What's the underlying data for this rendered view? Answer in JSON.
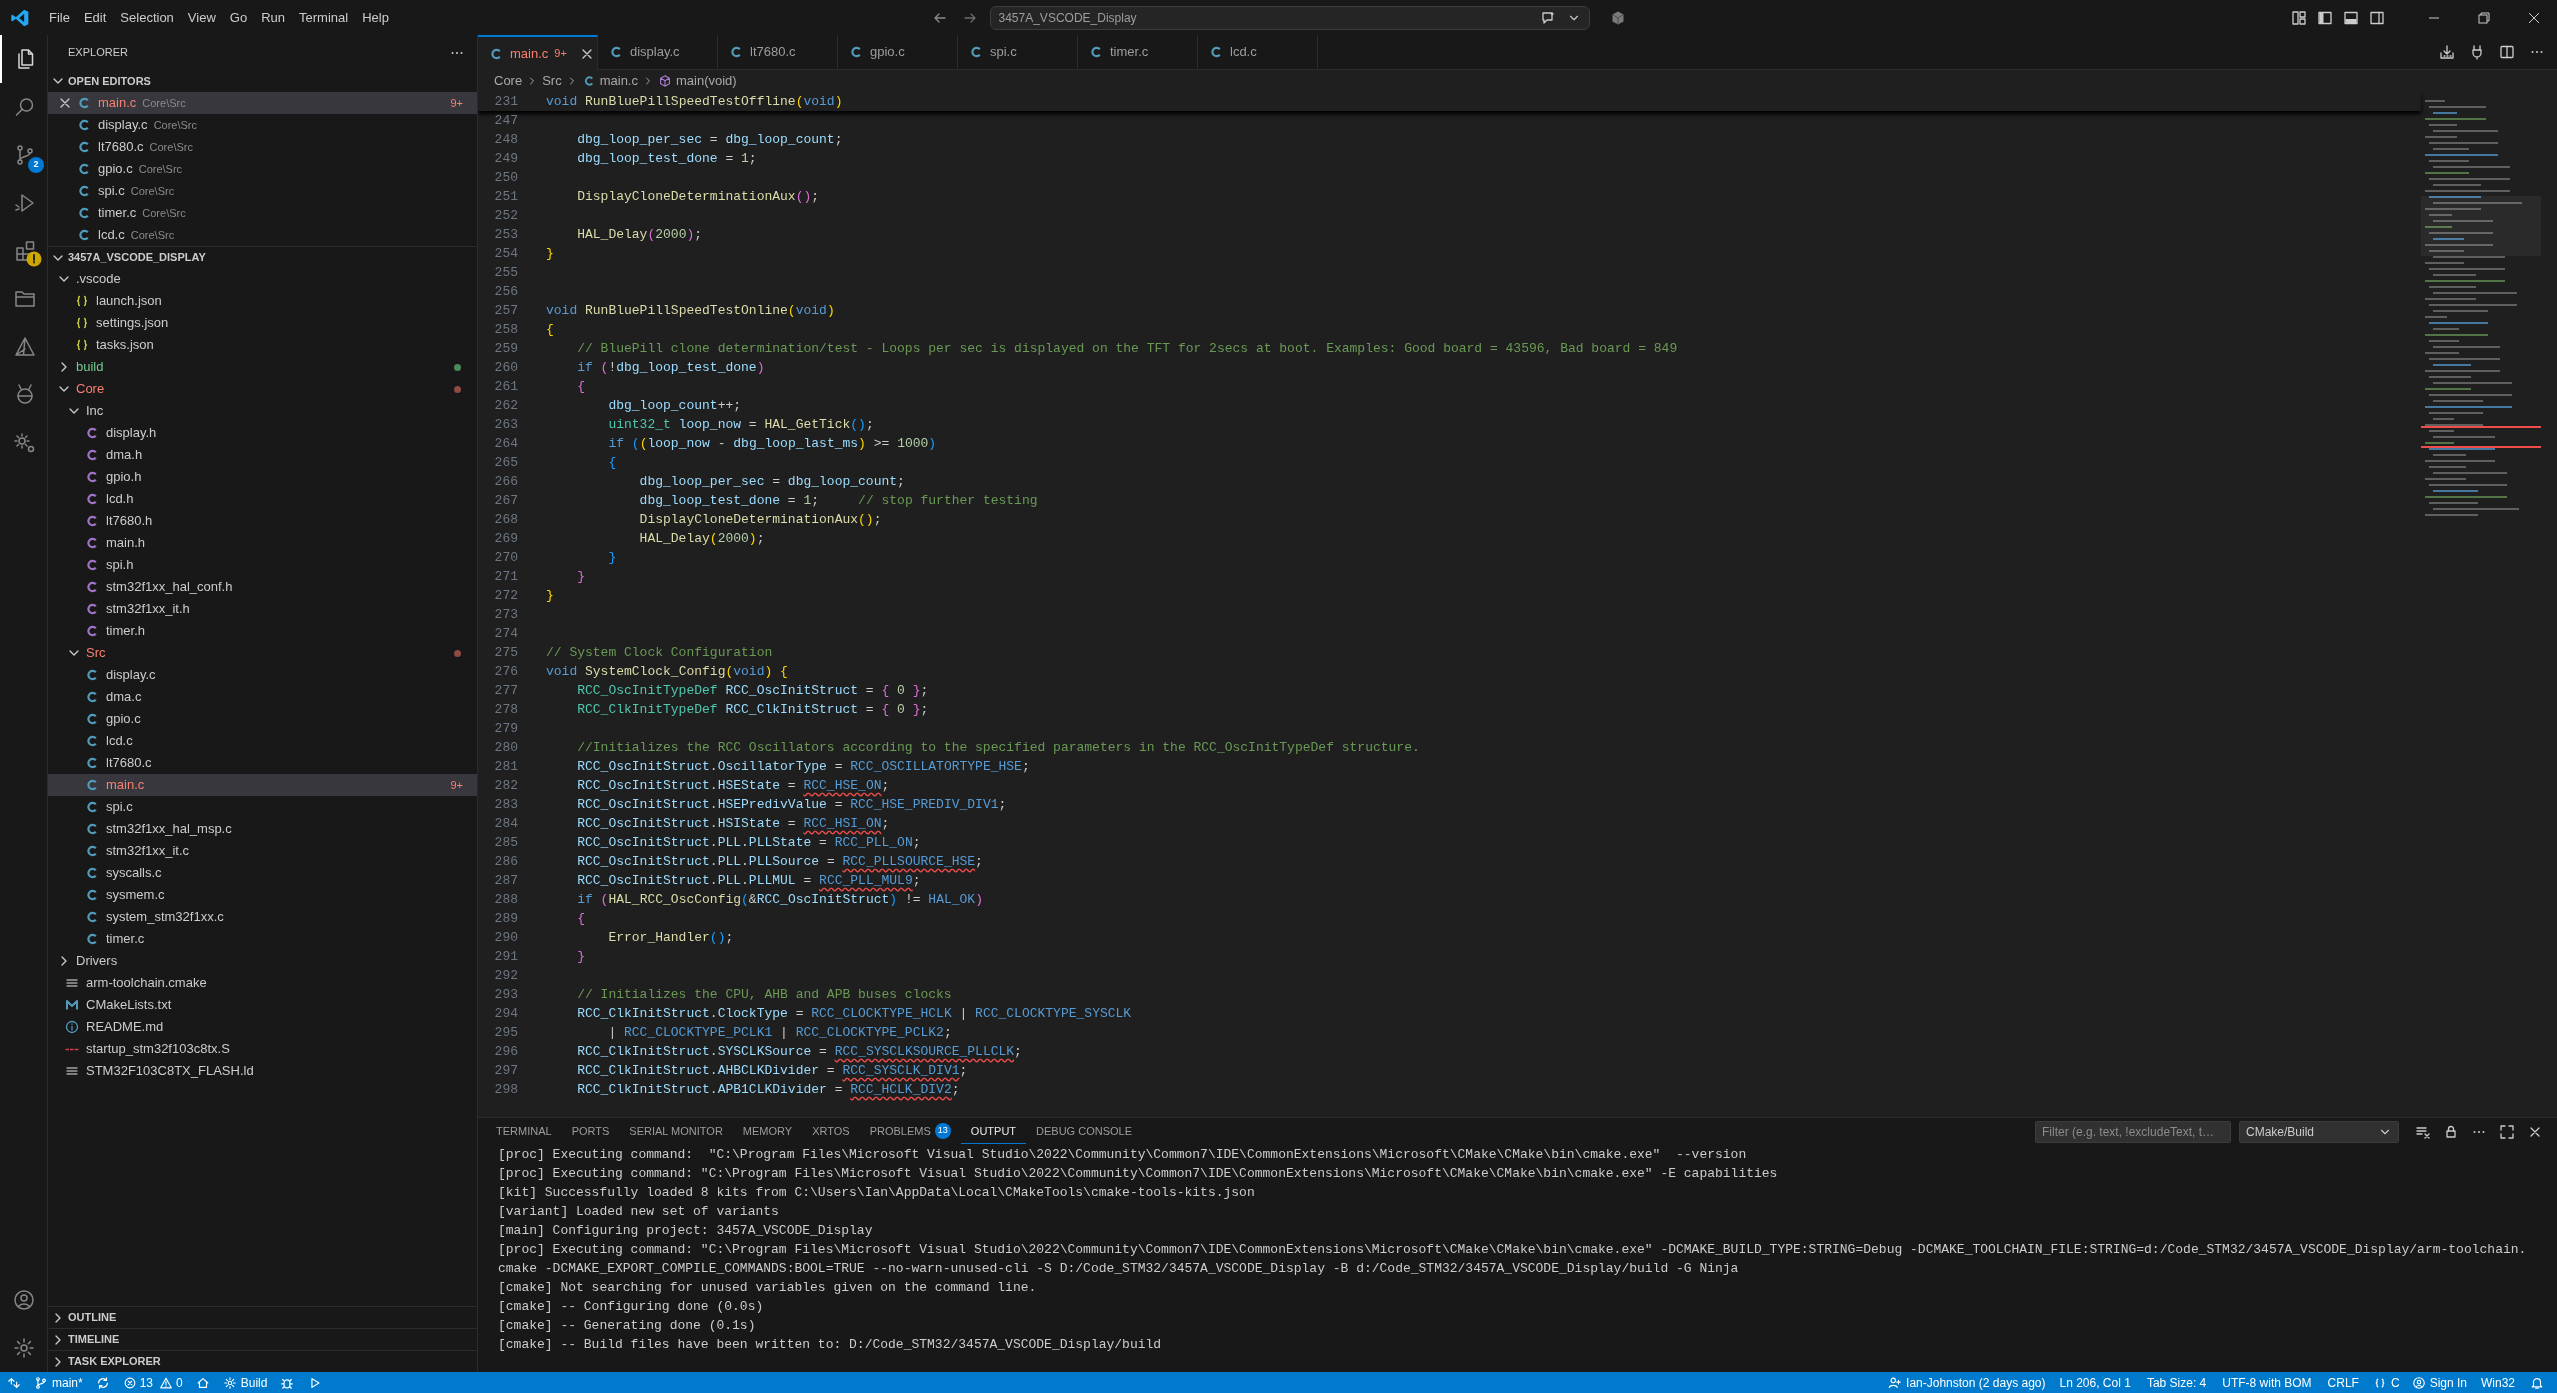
{
  "title_bar": {
    "menu": [
      "File",
      "Edit",
      "Selection",
      "View",
      "Go",
      "Run",
      "Terminal",
      "Help"
    ],
    "search": "3457A_VSCODE_Display"
  },
  "activity_bar": {
    "items": [
      {
        "kind": "explorer",
        "selected": true
      },
      {
        "kind": "search",
        "selected": false
      },
      {
        "kind": "scm",
        "selected": false,
        "badge": "2"
      },
      {
        "kind": "run",
        "selected": false
      },
      {
        "kind": "extensions",
        "selected": false,
        "warning": true
      },
      {
        "kind": "folder",
        "selected": false
      },
      {
        "kind": "cmake",
        "selected": false
      },
      {
        "kind": "platformio",
        "selected": false
      },
      {
        "kind": "gears",
        "selected": false
      }
    ],
    "bottom": [
      {
        "kind": "account"
      },
      {
        "kind": "settings"
      }
    ]
  },
  "explorer": {
    "title": "EXPLORER",
    "open_editors": {
      "title": "OPEN EDITORS",
      "expanded": true,
      "items": [
        {
          "name": "main.c",
          "path": "Core\\Src",
          "kind": "c",
          "selected": true,
          "has_errors": true,
          "badge": "9+"
        },
        {
          "name": "display.c",
          "path": "Core\\Src",
          "kind": "c",
          "selected": false
        },
        {
          "name": "lt7680.c",
          "path": "Core\\Src",
          "kind": "c",
          "selected": false
        },
        {
          "name": "gpio.c",
          "path": "Core\\Src",
          "kind": "c",
          "selected": false
        },
        {
          "name": "spi.c",
          "path": "Core\\Src",
          "kind": "c",
          "selected": false
        },
        {
          "name": "timer.c",
          "path": "Core\\Src",
          "kind": "c",
          "selected": false
        },
        {
          "name": "lcd.c",
          "path": "Core\\Src",
          "kind": "c",
          "selected": false
        }
      ]
    },
    "project": {
      "title": "3457A_VSCODE_DISPLAY",
      "expanded": true,
      "children": [
        {
          "name": ".vscode",
          "kind": "folder",
          "expanded": true,
          "children": [
            {
              "name": "launch.json",
              "kind": "json"
            },
            {
              "name": "settings.json",
              "kind": "json"
            },
            {
              "name": "tasks.json",
              "kind": "json"
            }
          ]
        },
        {
          "name": "build",
          "kind": "folder",
          "expanded": false,
          "untracked": true
        },
        {
          "name": "Core",
          "kind": "folder",
          "expanded": true,
          "has_errors": true,
          "children": [
            {
              "name": "Inc",
              "kind": "folder",
              "expanded": true,
              "children": [
                {
                  "name": "display.h",
                  "kind": "h"
                },
                {
                  "name": "dma.h",
                  "kind": "h"
                },
                {
                  "name": "gpio.h",
                  "kind": "h"
                },
                {
                  "name": "lcd.h",
                  "kind": "h"
                },
                {
                  "name": "lt7680.h",
                  "kind": "h"
                },
                {
                  "name": "main.h",
                  "kind": "h"
                },
                {
                  "name": "spi.h",
                  "kind": "h"
                },
                {
                  "name": "stm32f1xx_hal_conf.h",
                  "kind": "h"
                },
                {
                  "name": "stm32f1xx_it.h",
                  "kind": "h"
                },
                {
                  "name": "timer.h",
                  "kind": "h"
                }
              ]
            },
            {
              "name": "Src",
              "kind": "folder",
              "expanded": true,
              "has_errors": true,
              "children": [
                {
                  "name": "display.c",
                  "kind": "c"
                },
                {
                  "name": "dma.c",
                  "kind": "c"
                },
                {
                  "name": "gpio.c",
                  "kind": "c"
                },
                {
                  "name": "lcd.c",
                  "kind": "c"
                },
                {
                  "name": "lt7680.c",
                  "kind": "c"
                },
                {
                  "name": "main.c",
                  "kind": "c",
                  "selected": true,
                  "has_errors": true,
                  "badge": "9+"
                },
                {
                  "name": "spi.c",
                  "kind": "c"
                },
                {
                  "name": "stm32f1xx_hal_msp.c",
                  "kind": "c"
                },
                {
                  "name": "stm32f1xx_it.c",
                  "kind": "c"
                },
                {
                  "name": "syscalls.c",
                  "kind": "c"
                },
                {
                  "name": "sysmem.c",
                  "kind": "c"
                },
                {
                  "name": "system_stm32f1xx.c",
                  "kind": "c"
                },
                {
                  "name": "timer.c",
                  "kind": "c"
                }
              ]
            }
          ]
        },
        {
          "name": "Drivers",
          "kind": "folder",
          "expanded": false
        },
        {
          "name": "arm-toolchain.cmake",
          "kind": "lines"
        },
        {
          "name": "CMakeLists.txt",
          "kind": "cmakelists"
        },
        {
          "name": "README.md",
          "kind": "info"
        },
        {
          "name": "startup_stm32f103c8tx.S",
          "kind": "asm"
        },
        {
          "name": "STM32F103C8TX_FLASH.ld",
          "kind": "lines"
        }
      ]
    },
    "sections": [
      {
        "title": "OUTLINE",
        "expanded": false
      },
      {
        "title": "TIMELINE",
        "expanded": false
      },
      {
        "title": "TASK EXPLORER",
        "expanded": false
      }
    ]
  },
  "tabs": [
    {
      "label": "main.c",
      "selected": true,
      "has_errors": true,
      "badge": "9+"
    },
    {
      "label": "display.c",
      "selected": false
    },
    {
      "label": "lt7680.c",
      "selected": false
    },
    {
      "label": "gpio.c",
      "selected": false
    },
    {
      "label": "spi.c",
      "selected": false
    },
    {
      "label": "timer.c",
      "selected": false
    },
    {
      "label": "lcd.c",
      "selected": false
    }
  ],
  "breadcrumb": [
    {
      "label": "Core",
      "kind": "folder"
    },
    {
      "label": "Src",
      "kind": "folder"
    },
    {
      "label": "main.c",
      "kind": "file"
    },
    {
      "label": "main(void)",
      "kind": "function"
    }
  ],
  "editor": {
    "sticky": {
      "number": "231",
      "segments": [
        {
          "kind": "k",
          "text": "void "
        },
        {
          "kind": "f",
          "text": "RunBluePillSpeedTestOffline"
        },
        {
          "kind": "y",
          "text": "("
        },
        {
          "kind": "k",
          "text": "void"
        },
        {
          "kind": "y",
          "text": ")"
        }
      ]
    },
    "lines": [
      {
        "number": "247"
      },
      {
        "number": "248",
        "segments": [
          {
            "kind": "v",
            "text": "    dbg_loop_per_sec"
          },
          {
            "kind": "p",
            "text": " = "
          },
          {
            "kind": "v",
            "text": "dbg_loop_count"
          },
          {
            "kind": "p",
            "text": ";"
          }
        ]
      },
      {
        "number": "249",
        "segments": [
          {
            "kind": "v",
            "text": "    dbg_loop_test_done"
          },
          {
            "kind": "p",
            "text": " = "
          },
          {
            "kind": "n",
            "text": "1"
          },
          {
            "kind": "p",
            "text": ";"
          }
        ]
      },
      {
        "number": "250"
      },
      {
        "number": "251",
        "segments": [
          {
            "kind": "f",
            "text": "    DisplayCloneDeterminationAux"
          },
          {
            "kind": "pk",
            "text": "()"
          },
          {
            "kind": "p",
            "text": ";"
          }
        ]
      },
      {
        "number": "252"
      },
      {
        "number": "253",
        "segments": [
          {
            "kind": "f",
            "text": "    HAL_Delay"
          },
          {
            "kind": "pk",
            "text": "("
          },
          {
            "kind": "n",
            "text": "2000"
          },
          {
            "kind": "pk",
            "text": ")"
          },
          {
            "kind": "p",
            "text": ";"
          }
        ]
      },
      {
        "number": "254",
        "segments": [
          {
            "kind": "y",
            "text": "}"
          }
        ]
      },
      {
        "number": "255"
      },
      {
        "number": "256"
      },
      {
        "number": "257",
        "segments": [
          {
            "kind": "k",
            "text": "void "
          },
          {
            "kind": "f",
            "text": "RunBluePillSpeedTestOnline"
          },
          {
            "kind": "y",
            "text": "("
          },
          {
            "kind": "k",
            "text": "void"
          },
          {
            "kind": "y",
            "text": ")"
          }
        ]
      },
      {
        "number": "258",
        "segments": [
          {
            "kind": "y",
            "text": "{"
          }
        ]
      },
      {
        "number": "259",
        "segments": [
          {
            "kind": "c",
            "text": "    // BluePill clone determination/test - Loops per sec is displayed on the TFT for 2secs at boot. Examples: Good board = 43596, Bad board = 849"
          }
        ]
      },
      {
        "number": "260",
        "segments": [
          {
            "kind": "k",
            "text": "    if "
          },
          {
            "kind": "pk",
            "text": "("
          },
          {
            "kind": "p",
            "text": "!"
          },
          {
            "kind": "v",
            "text": "dbg_loop_test_done"
          },
          {
            "kind": "pk",
            "text": ")"
          }
        ]
      },
      {
        "number": "261",
        "segments": [
          {
            "kind": "pk",
            "text": "    {"
          }
        ]
      },
      {
        "number": "262",
        "segments": [
          {
            "kind": "v",
            "text": "        dbg_loop_count"
          },
          {
            "kind": "p",
            "text": "++;"
          }
        ]
      },
      {
        "number": "263",
        "segments": [
          {
            "kind": "t",
            "text": "        uint32_t "
          },
          {
            "kind": "v",
            "text": "loop_now"
          },
          {
            "kind": "p",
            "text": " = "
          },
          {
            "kind": "f",
            "text": "HAL_GetTick"
          },
          {
            "kind": "bl",
            "text": "()"
          },
          {
            "kind": "p",
            "text": ";"
          }
        ]
      },
      {
        "number": "264",
        "segments": [
          {
            "kind": "k",
            "text": "        if "
          },
          {
            "kind": "bl",
            "text": "("
          },
          {
            "kind": "y",
            "text": "("
          },
          {
            "kind": "v",
            "text": "loop_now"
          },
          {
            "kind": "p",
            "text": " - "
          },
          {
            "kind": "v",
            "text": "dbg_loop_last_ms"
          },
          {
            "kind": "y",
            "text": ")"
          },
          {
            "kind": "p",
            "text": " >= "
          },
          {
            "kind": "n",
            "text": "1000"
          },
          {
            "kind": "bl",
            "text": ")"
          }
        ]
      },
      {
        "number": "265",
        "segments": [
          {
            "kind": "bl",
            "text": "        {"
          }
        ]
      },
      {
        "number": "266",
        "segments": [
          {
            "kind": "v",
            "text": "            dbg_loop_per_sec"
          },
          {
            "kind": "p",
            "text": " = "
          },
          {
            "kind": "v",
            "text": "dbg_loop_count"
          },
          {
            "kind": "p",
            "text": ";"
          }
        ]
      },
      {
        "number": "267",
        "segments": [
          {
            "kind": "v",
            "text": "            dbg_loop_test_done"
          },
          {
            "kind": "p",
            "text": " = "
          },
          {
            "kind": "n",
            "text": "1"
          },
          {
            "kind": "p",
            "text": ";     "
          },
          {
            "kind": "c",
            "text": "// stop further testing"
          }
        ]
      },
      {
        "number": "268",
        "segments": [
          {
            "kind": "f",
            "text": "            DisplayCloneDeterminationAux"
          },
          {
            "kind": "y",
            "text": "()"
          },
          {
            "kind": "p",
            "text": ";"
          }
        ]
      },
      {
        "number": "269",
        "segments": [
          {
            "kind": "f",
            "text": "            HAL_Delay"
          },
          {
            "kind": "y",
            "text": "("
          },
          {
            "kind": "n",
            "text": "2000"
          },
          {
            "kind": "y",
            "text": ")"
          },
          {
            "kind": "p",
            "text": ";"
          }
        ]
      },
      {
        "number": "270",
        "segments": [
          {
            "kind": "bl",
            "text": "        }"
          }
        ]
      },
      {
        "number": "271",
        "segments": [
          {
            "kind": "pk",
            "text": "    }"
          }
        ]
      },
      {
        "number": "272",
        "segments": [
          {
            "kind": "y",
            "text": "}"
          }
        ]
      },
      {
        "number": "273"
      },
      {
        "number": "274"
      },
      {
        "number": "275",
        "segments": [
          {
            "kind": "c",
            "text": "// System Clock Configuration"
          }
        ]
      },
      {
        "number": "276",
        "segments": [
          {
            "kind": "k",
            "text": "void "
          },
          {
            "kind": "f",
            "text": "SystemClock_Config"
          },
          {
            "kind": "y",
            "text": "("
          },
          {
            "kind": "k",
            "text": "void"
          },
          {
            "kind": "y",
            "text": ") {"
          }
        ]
      },
      {
        "number": "277",
        "segments": [
          {
            "kind": "t",
            "text": "    RCC_OscInitTypeDef "
          },
          {
            "kind": "v",
            "text": "RCC_OscInitStruct"
          },
          {
            "kind": "p",
            "text": " = "
          },
          {
            "kind": "pk",
            "text": "{"
          },
          {
            "kind": "n",
            "text": " 0 "
          },
          {
            "kind": "pk",
            "text": "}"
          },
          {
            "kind": "p",
            "text": ";"
          }
        ]
      },
      {
        "number": "278",
        "segments": [
          {
            "kind": "t",
            "text": "    RCC_ClkInitTypeDef "
          },
          {
            "kind": "v",
            "text": "RCC_ClkInitStruct"
          },
          {
            "kind": "p",
            "text": " = "
          },
          {
            "kind": "pk",
            "text": "{"
          },
          {
            "kind": "n",
            "text": " 0 "
          },
          {
            "kind": "pk",
            "text": "}"
          },
          {
            "kind": "p",
            "text": ";"
          }
        ]
      },
      {
        "number": "279"
      },
      {
        "number": "280",
        "segments": [
          {
            "kind": "c",
            "text": "    //Initializes the RCC Oscillators according to the specified parameters in the RCC_OscInitTypeDef structure."
          }
        ]
      },
      {
        "number": "281",
        "segments": [
          {
            "kind": "v",
            "text": "    RCC_OscInitStruct"
          },
          {
            "kind": "p",
            "text": "."
          },
          {
            "kind": "v",
            "text": "OscillatorType"
          },
          {
            "kind": "p",
            "text": " = "
          },
          {
            "kind": "m",
            "text": "RCC_OSCILLATORTYPE_HSE"
          },
          {
            "kind": "p",
            "text": ";"
          }
        ]
      },
      {
        "number": "282",
        "segments": [
          {
            "kind": "v",
            "text": "    RCC_OscInitStruct"
          },
          {
            "kind": "p",
            "text": "."
          },
          {
            "kind": "v",
            "text": "HSEState"
          },
          {
            "kind": "p",
            "text": " = "
          },
          {
            "kind": "e",
            "text": "RCC_HSE_ON"
          },
          {
            "kind": "p",
            "text": ";"
          }
        ]
      },
      {
        "number": "283",
        "segments": [
          {
            "kind": "v",
            "text": "    RCC_OscInitStruct"
          },
          {
            "kind": "p",
            "text": "."
          },
          {
            "kind": "v",
            "text": "HSEPredivValue"
          },
          {
            "kind": "p",
            "text": " = "
          },
          {
            "kind": "m",
            "text": "RCC_HSE_PREDIV_DIV1"
          },
          {
            "kind": "p",
            "text": ";"
          }
        ]
      },
      {
        "number": "284",
        "segments": [
          {
            "kind": "v",
            "text": "    RCC_OscInitStruct"
          },
          {
            "kind": "p",
            "text": "."
          },
          {
            "kind": "v",
            "text": "HSIState"
          },
          {
            "kind": "p",
            "text": " = "
          },
          {
            "kind": "e",
            "text": "RCC_HSI_ON"
          },
          {
            "kind": "p",
            "text": ";"
          }
        ]
      },
      {
        "number": "285",
        "segments": [
          {
            "kind": "v",
            "text": "    RCC_OscInitStruct"
          },
          {
            "kind": "p",
            "text": "."
          },
          {
            "kind": "v",
            "text": "PLL"
          },
          {
            "kind": "p",
            "text": "."
          },
          {
            "kind": "v",
            "text": "PLLState"
          },
          {
            "kind": "p",
            "text": " = "
          },
          {
            "kind": "m",
            "text": "RCC_PLL_ON"
          },
          {
            "kind": "p",
            "text": ";"
          }
        ]
      },
      {
        "number": "286",
        "segments": [
          {
            "kind": "v",
            "text": "    RCC_OscInitStruct"
          },
          {
            "kind": "p",
            "text": "."
          },
          {
            "kind": "v",
            "text": "PLL"
          },
          {
            "kind": "p",
            "text": "."
          },
          {
            "kind": "v",
            "text": "PLLSource"
          },
          {
            "kind": "p",
            "text": " = "
          },
          {
            "kind": "e",
            "text": "RCC_PLLSOURCE_HSE"
          },
          {
            "kind": "p",
            "text": ";"
          }
        ]
      },
      {
        "number": "287",
        "segments": [
          {
            "kind": "v",
            "text": "    RCC_OscInitStruct"
          },
          {
            "kind": "p",
            "text": "."
          },
          {
            "kind": "v",
            "text": "PLL"
          },
          {
            "kind": "p",
            "text": "."
          },
          {
            "kind": "v",
            "text": "PLLMUL"
          },
          {
            "kind": "p",
            "text": " = "
          },
          {
            "kind": "e",
            "text": "RCC_PLL_MUL9"
          },
          {
            "kind": "p",
            "text": ";"
          }
        ]
      },
      {
        "number": "288",
        "segments": [
          {
            "kind": "k",
            "text": "    if "
          },
          {
            "kind": "pk",
            "text": "("
          },
          {
            "kind": "f",
            "text": "HAL_RCC_OscConfig"
          },
          {
            "kind": "bl",
            "text": "("
          },
          {
            "kind": "p",
            "text": "&"
          },
          {
            "kind": "v",
            "text": "RCC_OscInitStruct"
          },
          {
            "kind": "bl",
            "text": ")"
          },
          {
            "kind": "p",
            "text": " != "
          },
          {
            "kind": "m",
            "text": "HAL_OK"
          },
          {
            "kind": "pk",
            "text": ")"
          }
        ]
      },
      {
        "number": "289",
        "segments": [
          {
            "kind": "pk",
            "text": "    {"
          }
        ]
      },
      {
        "number": "290",
        "segments": [
          {
            "kind": "f",
            "text": "        Error_Handler"
          },
          {
            "kind": "bl",
            "text": "()"
          },
          {
            "kind": "p",
            "text": ";"
          }
        ]
      },
      {
        "number": "291",
        "segments": [
          {
            "kind": "pk",
            "text": "    }"
          }
        ]
      },
      {
        "number": "292"
      },
      {
        "number": "293",
        "segments": [
          {
            "kind": "c",
            "text": "    // Initializes the CPU, AHB and APB buses clocks"
          }
        ]
      },
      {
        "number": "294",
        "segments": [
          {
            "kind": "v",
            "text": "    RCC_ClkInitStruct"
          },
          {
            "kind": "p",
            "text": "."
          },
          {
            "kind": "v",
            "text": "ClockType"
          },
          {
            "kind": "p",
            "text": " = "
          },
          {
            "kind": "m",
            "text": "RCC_CLOCKTYPE_HCLK"
          },
          {
            "kind": "p",
            "text": " | "
          },
          {
            "kind": "m",
            "text": "RCC_CLOCKTYPE_SYSCLK"
          }
        ]
      },
      {
        "number": "295",
        "segments": [
          {
            "kind": "p",
            "text": "        | "
          },
          {
            "kind": "m",
            "text": "RCC_CLOCKTYPE_PCLK1"
          },
          {
            "kind": "p",
            "text": " | "
          },
          {
            "kind": "m",
            "text": "RCC_CLOCKTYPE_PCLK2"
          },
          {
            "kind": "p",
            "text": ";"
          }
        ]
      },
      {
        "number": "296",
        "segments": [
          {
            "kind": "v",
            "text": "    RCC_ClkInitStruct"
          },
          {
            "kind": "p",
            "text": "."
          },
          {
            "kind": "v",
            "text": "SYSCLKSource"
          },
          {
            "kind": "p",
            "text": " = "
          },
          {
            "kind": "e",
            "text": "RCC_SYSCLKSOURCE_PLLCLK"
          },
          {
            "kind": "p",
            "text": ";"
          }
        ]
      },
      {
        "number": "297",
        "segments": [
          {
            "kind": "v",
            "text": "    RCC_ClkInitStruct"
          },
          {
            "kind": "p",
            "text": "."
          },
          {
            "kind": "v",
            "text": "AHBCLKDivider"
          },
          {
            "kind": "p",
            "text": " = "
          },
          {
            "kind": "e",
            "text": "RCC_SYSCLK_DIV1"
          },
          {
            "kind": "p",
            "text": ";"
          }
        ]
      },
      {
        "number": "298",
        "segments": [
          {
            "kind": "v",
            "text": "    RCC_ClkInitStruct"
          },
          {
            "kind": "p",
            "text": "."
          },
          {
            "kind": "v",
            "text": "APB1CLKDivider"
          },
          {
            "kind": "p",
            "text": " = "
          },
          {
            "kind": "e",
            "text": "RCC_HCLK_DIV2"
          },
          {
            "kind": "p",
            "text": ";"
          }
        ]
      }
    ]
  },
  "panel": {
    "tabs": [
      {
        "label": "TERMINAL",
        "selected": false
      },
      {
        "label": "PORTS",
        "selected": false
      },
      {
        "label": "SERIAL MONITOR",
        "selected": false
      },
      {
        "label": "MEMORY",
        "selected": false
      },
      {
        "label": "XRTOS",
        "selected": false
      },
      {
        "label": "PROBLEMS",
        "selected": false,
        "badge": "13"
      },
      {
        "label": "OUTPUT",
        "selected": true
      },
      {
        "label": "DEBUG CONSOLE",
        "selected": false
      }
    ],
    "filter": {
      "placeholder": "Filter (e.g. text, !excludeText, t…"
    },
    "channel": "CMake/Build",
    "output": [
      "[proc] Executing command:  \"C:\\Program Files\\Microsoft Visual Studio\\2022\\Community\\Common7\\IDE\\CommonExtensions\\Microsoft\\CMake\\CMake\\bin\\cmake.exe\"  --version",
      "[proc] Executing command: \"C:\\Program Files\\Microsoft Visual Studio\\2022\\Community\\Common7\\IDE\\CommonExtensions\\Microsoft\\CMake\\CMake\\bin\\cmake.exe\" -E capabilities",
      "[kit] Successfully loaded 8 kits from C:\\Users\\Ian\\AppData\\Local\\CMakeTools\\cmake-tools-kits.json",
      "[variant] Loaded new set of variants",
      "[main] Configuring project: 3457A_VSCODE_Display",
      "[proc] Executing command: \"C:\\Program Files\\Microsoft Visual Studio\\2022\\Community\\Common7\\IDE\\CommonExtensions\\Microsoft\\CMake\\CMake\\bin\\cmake.exe\" -DCMAKE_BUILD_TYPE:STRING=Debug -DCMAKE_TOOLCHAIN_FILE:STRING=d:/Code_STM32/3457A_VSCODE_Display/arm-toolchain.",
      "cmake -DCMAKE_EXPORT_COMPILE_COMMANDS:BOOL=TRUE --no-warn-unused-cli -S D:/Code_STM32/3457A_VSCODE_Display -B d:/Code_STM32/3457A_VSCODE_Display/build -G Ninja",
      "[cmake] Not searching for unused variables given on the command line.",
      "[cmake] -- Configuring done (0.0s)",
      "[cmake] -- Generating done (0.1s)",
      "[cmake] -- Build files have been written to: D:/Code_STM32/3457A_VSCODE_Display/build"
    ]
  },
  "status_bar": {
    "left": [
      {
        "kind": "remote"
      },
      {
        "kind": "branch",
        "text": "main*"
      },
      {
        "kind": "sync"
      },
      {
        "kind": "problems",
        "errors": "13",
        "warnings": "0"
      },
      {
        "kind": "home"
      },
      {
        "kind": "build",
        "text": "Build"
      },
      {
        "kind": "debug"
      },
      {
        "kind": "run"
      }
    ],
    "right": [
      {
        "kind": "blame",
        "text": "Ian-Johnston (2 days ago)"
      },
      {
        "kind": "text",
        "text": "Ln 206, Col 1"
      },
      {
        "kind": "text",
        "text": "Tab Size: 4"
      },
      {
        "kind": "text",
        "text": "UTF-8 with BOM"
      },
      {
        "kind": "text",
        "text": "CRLF"
      },
      {
        "kind": "language",
        "text": "C"
      },
      {
        "kind": "account",
        "text": "Sign In"
      },
      {
        "kind": "text",
        "text": "Win32"
      },
      {
        "kind": "bell"
      }
    ]
  }
}
